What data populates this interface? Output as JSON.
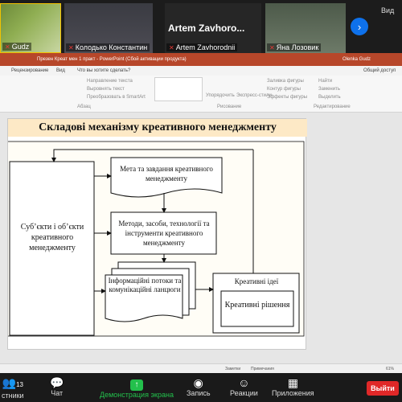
{
  "participants": [
    {
      "name": "Gudz"
    },
    {
      "name": "Колодько Константин"
    },
    {
      "name": "Artem Zavhorodnii",
      "big_name": "Artem Zavhoro..."
    },
    {
      "name": "Яна Лозовик"
    }
  ],
  "view_label": "Вид",
  "powerpoint": {
    "title": "Презен Креат мен 1 практ - PowerPoint (Сбой активации продукта)",
    "user": "Olenka Gudz",
    "menu": [
      "Рецензирование",
      "Вид",
      "Что вы хотите сделать?"
    ],
    "share": "Общий доступ",
    "ribbon_items": [
      "Направление текста",
      "Выровнять текст",
      "Преобразовать в SmartArt",
      "Упорядочить",
      "Экспресс-стили",
      "Заливка фигуры",
      "Контур фигуры",
      "Эффекты фигуры",
      "Найти",
      "Заменить",
      "Выделить"
    ],
    "ribbon_groups": [
      "Абзац",
      "Рисование",
      "Редактирование"
    ]
  },
  "slide": {
    "title": "Складові механізму креативного менеджменту",
    "subject_box": "Суб’єкти і об’єкти креативного менеджменту",
    "goals_box": "Мета та завдання креативного менеджменту",
    "methods_box": "Методи, засоби, технології та інструменти креативного менеджменту",
    "info_box": "Інформаційні потоки та комунікаційні ланцюги",
    "ideas_box": "Креативні ідеї",
    "solutions_box": "Креативні рішення"
  },
  "status": {
    "notes": "Заметки",
    "comments": "Примечания",
    "zoom": "61%"
  },
  "toolbar": {
    "participants_label": "стники",
    "participants_count": "13",
    "chat": "Чат",
    "share": "Демонстрация экрана",
    "record": "Запись",
    "reactions": "Реакции",
    "apps": "Приложения",
    "leave": "Выйти"
  },
  "colors": {
    "powerpoint_accent": "#b7472a",
    "share_green": "#23c04c",
    "leave_red": "#e02828",
    "slide_title_bg": "#fde9c6"
  }
}
